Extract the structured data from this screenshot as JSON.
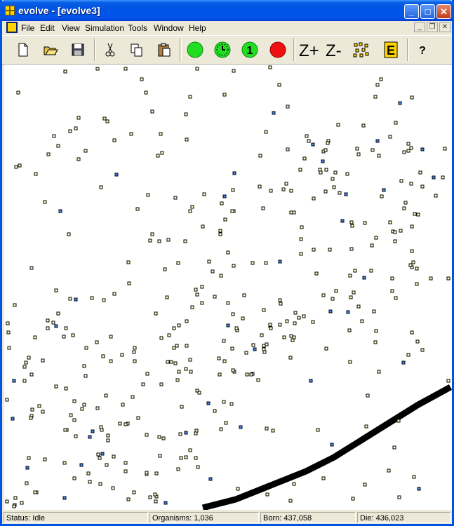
{
  "window": {
    "title": "evolve - [evolve3]"
  },
  "titlebar_buttons": {
    "minimize": "_",
    "maximize": "□",
    "close": "✕"
  },
  "menu": [
    "File",
    "Edit",
    "View",
    "Simulation",
    "Tools",
    "Window",
    "Help"
  ],
  "mdi_controls": {
    "minimize": "_",
    "restore": "❐",
    "close": "✕"
  },
  "toolbar": {
    "new": "new-document-icon",
    "open": "open-folder-icon",
    "save": "save-icon",
    "cut": "cut-icon",
    "copy": "copy-icon",
    "paste": "paste-icon",
    "run": "run-icon",
    "timer": "timer-icon",
    "step": "1",
    "stop": "stop-icon",
    "zoom_in": "Z+",
    "zoom_out": "Z-",
    "scatter": "scatter-view-icon",
    "energy": "E",
    "help": "?"
  },
  "status": {
    "state": "Status: Idle",
    "organisms": "Organisms: 1,036",
    "born": "Born: 437,058",
    "die": "Die: 436,023"
  },
  "colors": {
    "accent": "#0054e3",
    "run": "#22dd22",
    "stop": "#ee1111",
    "barrier": "#000000",
    "organism_border": "#000000",
    "organism_fill": "#ffffcc",
    "organism_alt": "#4488ff"
  }
}
